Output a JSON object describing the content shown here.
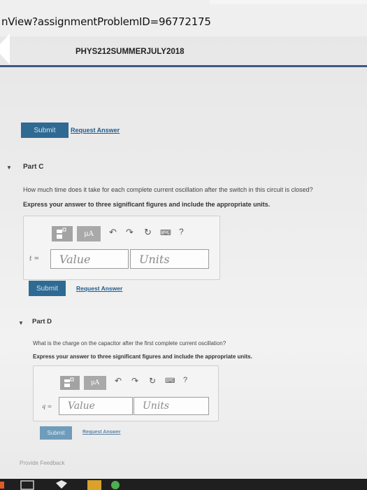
{
  "browser": {
    "url": "nView?assignmentProblemID=96772175"
  },
  "header": {
    "course_title": "PHYS212SUMMERJULY2018"
  },
  "part_b": {
    "submit_label": "Submit",
    "request_answer_label": "Request Answer"
  },
  "part_c": {
    "label": "Part C",
    "question": "How much time does it take for each complete current oscillation after the switch in this circuit is closed?",
    "instruction": "Express your answer to three significant figures and include the appropriate units.",
    "toolbar": {
      "unit_button": "μA",
      "help": "?"
    },
    "variable": "t =",
    "value_placeholder": "Value",
    "units_placeholder": "Units",
    "submit_label": "Submit",
    "request_answer_label": "Request Answer"
  },
  "part_d": {
    "label": "Part D",
    "question": "What is the charge on the capacitor after the first complete current oscillation?",
    "instruction": "Express your answer to three significant figures and include the appropriate units.",
    "toolbar": {
      "unit_button": "μA",
      "help": "?"
    },
    "variable": "q =",
    "value_placeholder": "Value",
    "units_placeholder": "Units",
    "submit_label": "Submit",
    "request_answer_label": "Request Answer"
  },
  "footer": {
    "provide_feedback": "Provide Feedback"
  }
}
